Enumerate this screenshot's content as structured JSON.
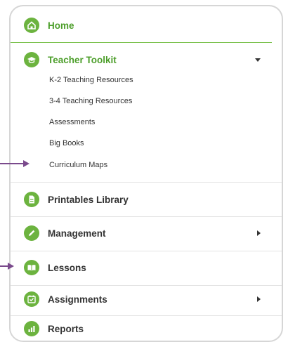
{
  "colors": {
    "accent": "#6cb33f",
    "accent_text": "#4c9e2a",
    "arrow": "#7a4a8c"
  },
  "nav": {
    "home": {
      "label": "Home",
      "icon": "home-icon"
    },
    "teacher_toolkit": {
      "label": "Teacher Toolkit",
      "icon": "graduation-cap-icon",
      "expanded": true,
      "items": [
        "K-2 Teaching Resources",
        "3-4 Teaching Resources",
        "Assessments",
        "Big Books",
        "Curriculum Maps"
      ]
    },
    "printables": {
      "label": "Printables Library",
      "icon": "document-icon"
    },
    "management": {
      "label": "Management",
      "icon": "pencil-icon"
    },
    "lessons": {
      "label": "Lessons",
      "icon": "book-icon"
    },
    "assignments": {
      "label": "Assignments",
      "icon": "calendar-check-icon"
    },
    "reports": {
      "label": "Reports",
      "icon": "chart-icon"
    }
  }
}
